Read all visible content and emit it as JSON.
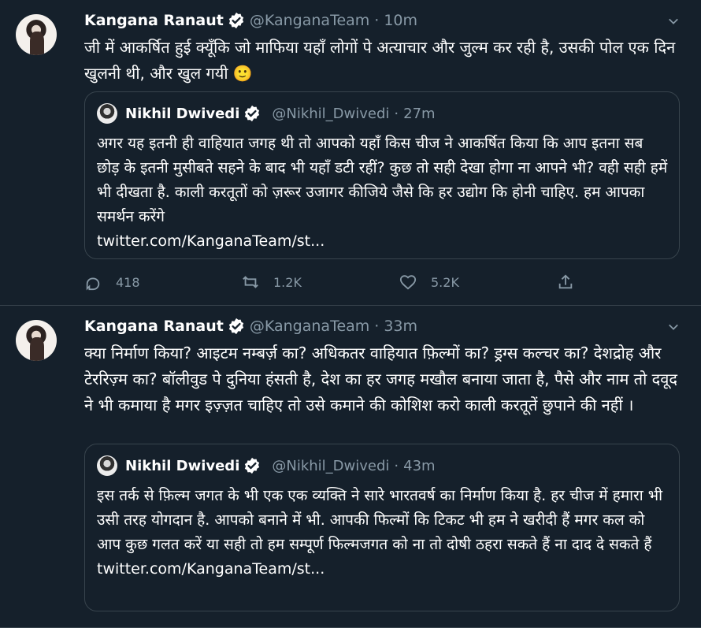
{
  "tweets": [
    {
      "author": "Kangana Ranaut",
      "handle": "@KanganaTeam",
      "time": "10m",
      "text": "जी में आकर्षित हुई क्यूँकि जो माफिया यहाँ लोगों पे अत्याचार और जुल्म कर रही है, उसकी पोल एक दिन खुलनी थी, और खुल गयी 🙂",
      "quote": {
        "author": "Nikhil Dwivedi",
        "handle": "@Nikhil_Dwivedi",
        "time": "27m",
        "text": "अगर यह इतनी ही वाहियात जगह थी तो आपको यहाँ किस चीज ने आकर्षित किया कि आप इतना सब छोड़ के इतनी मुसीबते सहने के बाद भी यहाँ डटी रहीं? कुछ तो सही देखा होगा ना आपने भी? वही सही हमें भी दीखता है. काली करतूतों को ज़रूर उजागर कीजिये जैसे कि हर उद्योग कि होनी चाहिए. हम आपका समर्थन करेंगे",
        "link": "twitter.com/KanganaTeam/st..."
      },
      "actions": {
        "replies": "418",
        "retweets": "1.2K",
        "likes": "5.2K"
      }
    },
    {
      "author": "Kangana Ranaut",
      "handle": "@KanganaTeam",
      "time": "33m",
      "text": "क्या निर्माण किया? आइटम नम्बर्ज़ का? अधिकतर वाहियात फ़िल्मों का? ड्रग्स कल्चर का? देशद्रोह और टेररिज़्म का? बॉलीवुड पे दुनिया हंसती है, देश का हर जगह मखौल बनाया जाता है, पैसे और नाम तो दवूद ने भी कमाया है मगर इज़्ज़त चाहिए तो उसे कमाने की कोशिश करो काली करतूतें छुपाने की नहीं ।",
      "quote": {
        "author": "Nikhil Dwivedi",
        "handle": "@Nikhil_Dwivedi",
        "time": "43m",
        "text": "इस तर्क से फ़िल्म जगत के भी एक एक व्यक्ति ने सारे भारतवर्ष का निर्माण किया है. हर चीज में हमारा भी उसी तरह योगदान है. आपको बनाने में भी. आपकी फिल्मों कि टिकट भी हम ने खरीदी हैं मगर कल को आप कुछ गलत करें या सही तो हम सम्पूर्ण फिल्मजगत को ना तो दोषी ठहरा सकते हैं ना दाद दे सकते हैं",
        "link": "twitter.com/KanganaTeam/st..."
      }
    }
  ],
  "colors": {
    "background": "#15202b",
    "border": "#38444d",
    "muted": "#8899a6",
    "verified": "#1da1f2"
  }
}
